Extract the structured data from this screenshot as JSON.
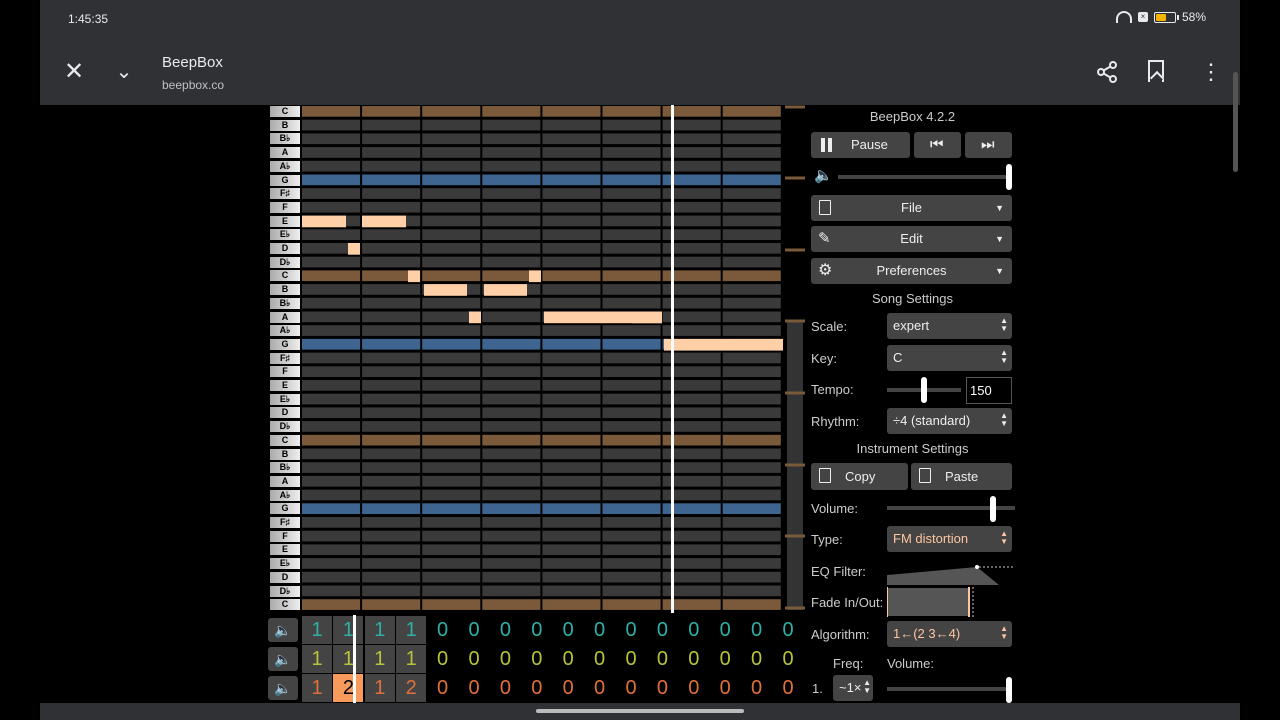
{
  "status": {
    "time": "1:45:35",
    "battery": "58%"
  },
  "header": {
    "title": "BeepBox",
    "url": "beepbox.co"
  },
  "piano": {
    "keys": [
      "C",
      "B",
      "B♭",
      "A",
      "A♭",
      "G",
      "F♯",
      "F",
      "E",
      "E♭",
      "D",
      "D♭",
      "C",
      "B",
      "B♭",
      "A",
      "A♭",
      "G",
      "F♯",
      "F",
      "E",
      "E♭",
      "D",
      "D♭",
      "C",
      "B",
      "B♭",
      "A",
      "A♭",
      "G",
      "F♯",
      "F",
      "E",
      "E♭",
      "D",
      "D♭",
      "C"
    ]
  },
  "patterns": {
    "rows": [
      {
        "color": "#2fb0a6",
        "values": [
          "1",
          "1",
          "1",
          "1",
          "0",
          "0",
          "0",
          "0",
          "0",
          "0",
          "0",
          "0",
          "0",
          "0",
          "0",
          "0"
        ]
      },
      {
        "color": "#b9c33a",
        "values": [
          "1",
          "1",
          "1",
          "1",
          "0",
          "0",
          "0",
          "0",
          "0",
          "0",
          "0",
          "0",
          "0",
          "0",
          "0",
          "0"
        ]
      },
      {
        "color": "#e0703a",
        "values": [
          "1",
          "2",
          "1",
          "2",
          "0",
          "0",
          "0",
          "0",
          "0",
          "0",
          "0",
          "0",
          "0",
          "0",
          "0",
          "0"
        ]
      }
    ]
  },
  "panel": {
    "version": "BeepBox 4.2.2",
    "pause_label": "Pause",
    "file_label": "File",
    "edit_label": "Edit",
    "prefs_label": "Preferences",
    "song_settings": "Song Settings",
    "scale_label": "Scale:",
    "scale_value": "expert",
    "key_label": "Key:",
    "key_value": "C",
    "tempo_label": "Tempo:",
    "tempo_value": "150",
    "rhythm_label": "Rhythm:",
    "rhythm_value": "÷4 (standard)",
    "instrument_settings": "Instrument Settings",
    "copy_label": "Copy",
    "paste_label": "Paste",
    "volume_label": "Volume:",
    "type_label": "Type:",
    "type_value": "FM distortion",
    "eq_label": "EQ Filter:",
    "fade_label": "Fade In/Out:",
    "algorithm_label": "Algorithm:",
    "algorithm_value": "1←(2 3←4)",
    "freq_label": "Freq:",
    "op_volume_label": "Volume:",
    "op_index": "1.",
    "op_freq_value": "~1×"
  },
  "colors": {
    "accent": "#ffc6a0",
    "note": "#ffcfa8",
    "tonic_row": "#7a5a3a",
    "fifth_row": "#3d6590",
    "row": "#3a3a3a"
  }
}
